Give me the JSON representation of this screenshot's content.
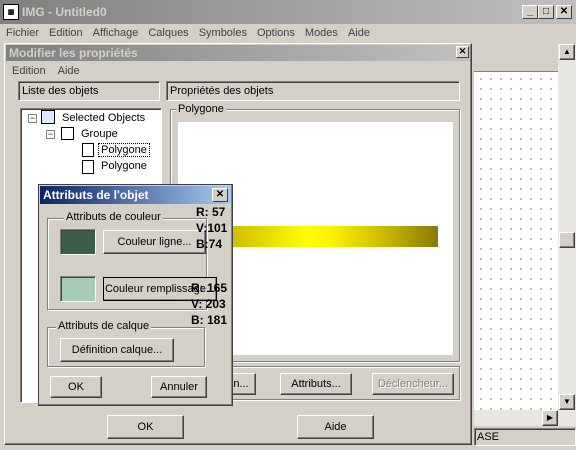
{
  "main_window": {
    "title": "IMG - Untitled0",
    "menu": [
      "Fichier",
      "Edition",
      "Affichage",
      "Calques",
      "Symboles",
      "Options",
      "Modes",
      "Aide"
    ],
    "status_text": "ASE"
  },
  "properties_dialog": {
    "title": "Modifier les propriétés",
    "menu": [
      "Edition",
      "Aide"
    ],
    "list_header": "Liste des objets",
    "props_header": "Propriétés des objets",
    "group_label": "Polygone",
    "tree": {
      "root": "Selected Objects",
      "group": "Groupe",
      "items": [
        "Polygone",
        "Polygone"
      ]
    },
    "buttons": {
      "partial_left": "n...",
      "attributs": "Attributs...",
      "declencheur": "Déclencheur...",
      "ok": "OK",
      "aide": "Aide"
    }
  },
  "attr_dialog": {
    "title": "Attributs de l'objet",
    "close": "✕",
    "color_group": "Attributs de couleur",
    "line_button": "Couleur ligne...",
    "fill_button": "Couleur remplissage...",
    "layer_group": "Attributs de calque",
    "layer_button": "Définition calque...",
    "ok": "OK",
    "cancel": "Annuler",
    "line_color": "#395f48",
    "fill_color": "#a5cbb5",
    "line_rgb": [
      "R: 57",
      "V:101",
      "B:74"
    ],
    "fill_rgb": [
      "R: 165",
      "V: 203",
      "B: 181"
    ]
  },
  "colors": {
    "title_active": "#0a246a",
    "title_inactive": "#808080",
    "gradient_dark": "#8a7b00",
    "gradient_light": "#ffff00"
  }
}
